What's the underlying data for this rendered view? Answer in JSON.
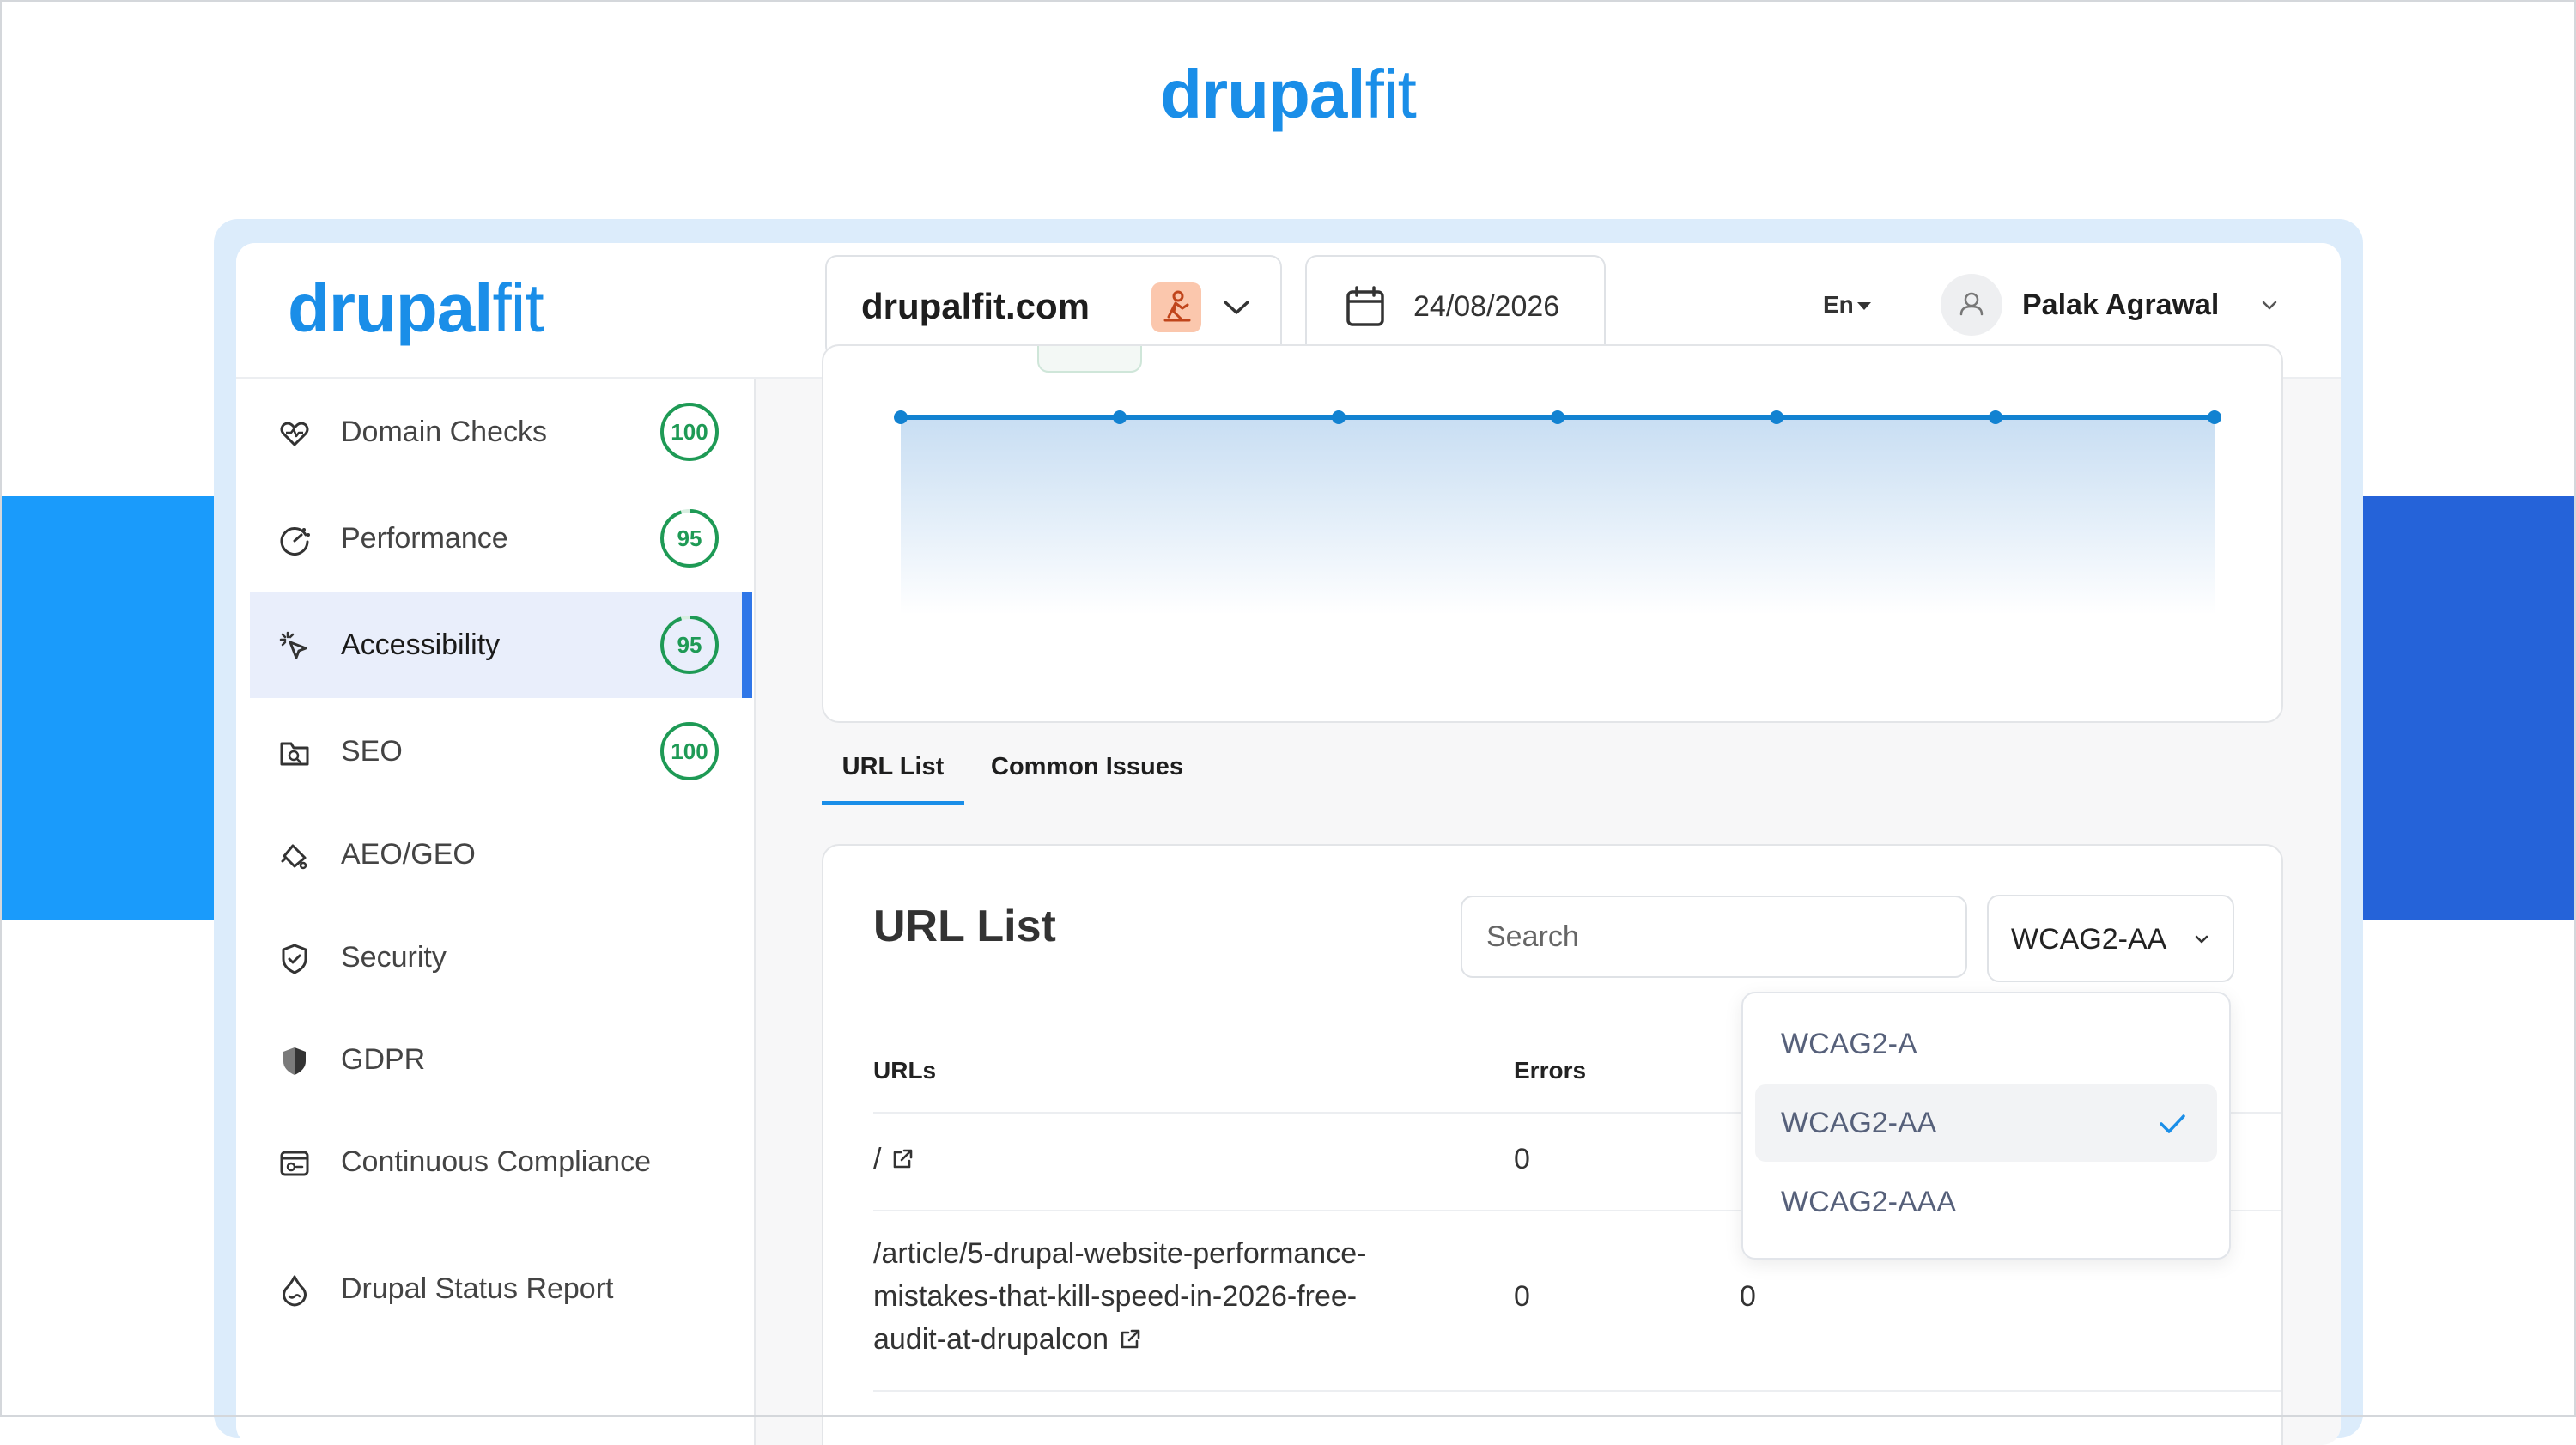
{
  "brand": {
    "logo_bold": "drupal",
    "logo_light": "fit"
  },
  "header": {
    "site": "drupalfit.com",
    "date": "24/08/2026",
    "language": "En",
    "user_name": "Palak Agrawal"
  },
  "sidebar": {
    "items": [
      {
        "label": "Domain Checks",
        "score": "100",
        "score_value": 100
      },
      {
        "label": "Performance",
        "score": "95",
        "score_value": 95
      },
      {
        "label": "Accessibility",
        "score": "95",
        "score_value": 95
      },
      {
        "label": "SEO",
        "score": "100",
        "score_value": 100
      },
      {
        "label": "AEO/GEO"
      },
      {
        "label": "Security"
      },
      {
        "label": "GDPR"
      },
      {
        "label": "Continuous Compliance"
      },
      {
        "label": "Drupal Status Report"
      }
    ],
    "active_index": 2
  },
  "tabs": [
    {
      "label": "URL List",
      "active": true
    },
    {
      "label": "Common Issues",
      "active": false
    }
  ],
  "url_list": {
    "title": "URL List",
    "search_placeholder": "Search",
    "standard": "WCAG2-AA",
    "columns": [
      "URLs",
      "Errors"
    ],
    "rows": [
      {
        "url": "/",
        "errors": "0",
        "warnings": ""
      },
      {
        "url": "/article/5-drupal-website-performance-mistakes-that-kill-speed-in-2026-free-audit-at-drupalcon",
        "url_lines": [
          "/article/5-drupal-website-performance-",
          "mistakes-that-kill-speed-in-2026-free-",
          "audit-at-drupalcon"
        ],
        "errors": "0",
        "warnings": "0"
      }
    ]
  },
  "standard_dropdown": {
    "options": [
      "WCAG2-A",
      "WCAG2-AA",
      "WCAG2-AAA"
    ],
    "selected": "WCAG2-AA"
  },
  "colors": {
    "brand_blue": "#1a8ee8",
    "score_green": "#1e9a55",
    "active_bar": "#2f76e8"
  }
}
